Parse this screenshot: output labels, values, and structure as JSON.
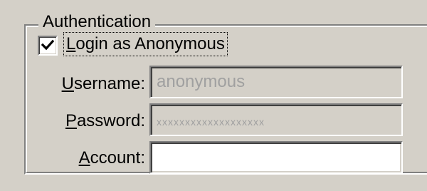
{
  "group": {
    "title": "Authentication"
  },
  "anonymous_checkbox": {
    "label_mnemonic": "L",
    "label_rest": "ogin as Anonymous",
    "checked": true
  },
  "fields": {
    "username": {
      "label_mnemonic": "U",
      "label_rest": "sername:",
      "value": "anonymous",
      "enabled": false
    },
    "password": {
      "label_mnemonic": "P",
      "label_rest": "assword:",
      "value": "xxxxxxxxxxxxxxxxxxx",
      "enabled": false
    },
    "account": {
      "label_mnemonic": "A",
      "label_rest": "ccount:",
      "value": "",
      "enabled": true
    }
  },
  "colors": {
    "dialog_bg": "#d4d0c8",
    "disabled_text": "#a0a0a0",
    "field_enabled_bg": "#ffffff"
  }
}
